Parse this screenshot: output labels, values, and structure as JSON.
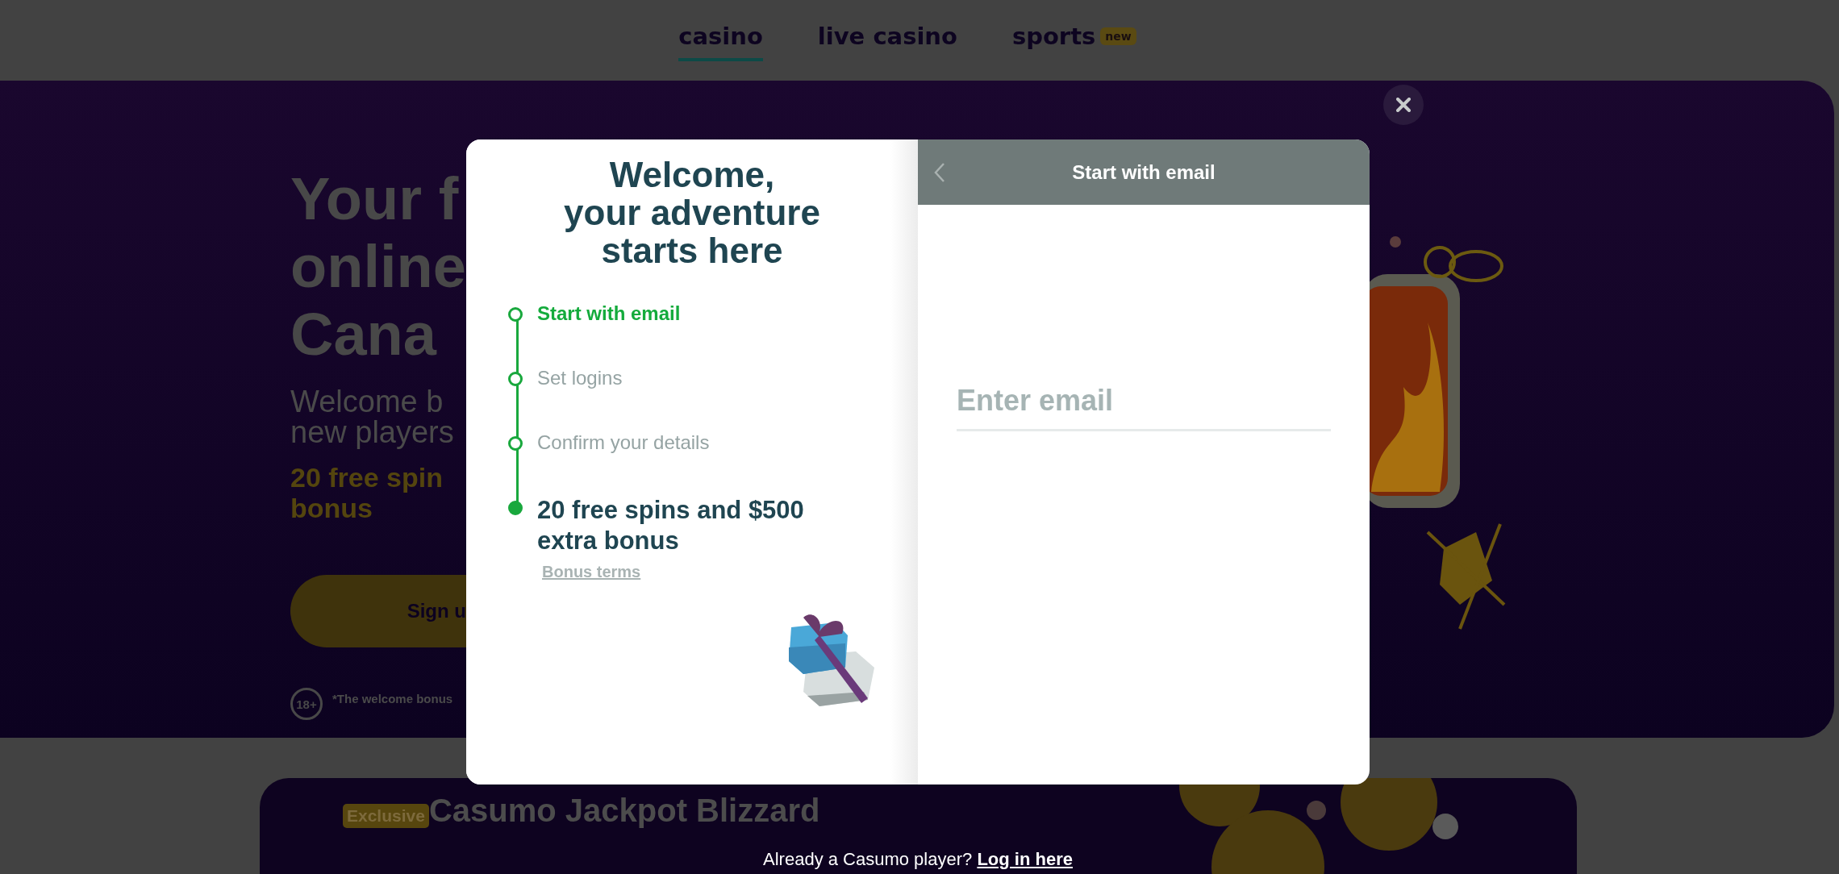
{
  "nav": {
    "tabs": [
      {
        "label": "casino",
        "selected": true
      },
      {
        "label": "live casino",
        "selected": false
      },
      {
        "label": "sports",
        "selected": false,
        "badge": "new"
      }
    ]
  },
  "hero": {
    "headline": [
      "Your f",
      "online",
      "Cana"
    ],
    "subtitle": [
      "Welcome b",
      "new players"
    ],
    "offer": [
      "20 free spin",
      "bonus"
    ],
    "button": "Sign u",
    "age_badge": "18+",
    "disclaimer": "*The welcome bonus"
  },
  "promo": {
    "badge": "Exclusive",
    "title": "Casumo Jackpot Blizzard"
  },
  "modal": {
    "title": [
      "Welcome,",
      "your adventure",
      "starts here"
    ],
    "steps": [
      {
        "kind": "step",
        "label": "Start with email",
        "selected": true
      },
      {
        "kind": "step",
        "label": "Set logins",
        "selected": false
      },
      {
        "kind": "step",
        "label": "Confirm your details",
        "selected": false
      },
      {
        "kind": "reward",
        "label": "20 free spins and $500 extra bonus",
        "selected": false
      }
    ],
    "bonus_terms": "Bonus terms",
    "header_title": "Start with email",
    "email": {
      "placeholder": "Enter email"
    }
  },
  "footer": {
    "text": "Already a Casumo player?",
    "link": "Log in here"
  }
}
